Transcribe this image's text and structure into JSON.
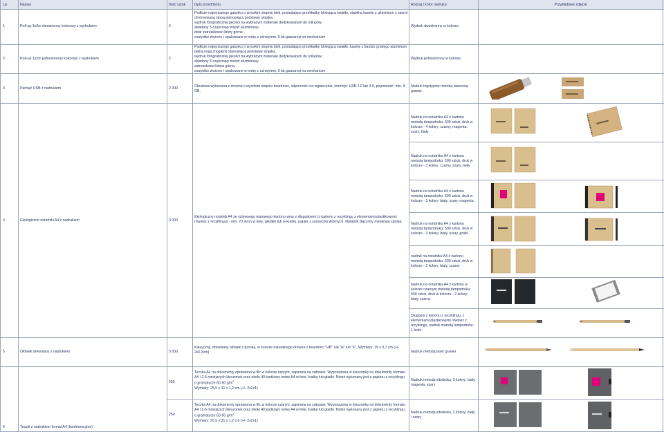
{
  "header": {
    "lp": "Lp.",
    "nazwa": "Nazwa",
    "ilosc": "Ilość sztuk",
    "opis": "Opis przedmiotu",
    "rodzaj": "Rodzaj i kolor nadruku",
    "zdjecie": "Przykładowe zdjęcie"
  },
  "rows": [
    {
      "lp": "1",
      "nazwa": "Roll-up 1x2m dwustronny kolorowy z wydrukiem",
      "ilosc": "2",
      "opis_lines": [
        "Podłoże najwyższego gatunku o wysokim stopniu bieli, posiadające przekładkę blokującą światło, stabilną kasetę z aluminium z szeroką,",
        "chromowaną stopą stanowiącą podstawę stojaka,",
        "wydruk fotograficznej jakości na wybranym materiale dedykowanym do rollupów,",
        " składany 3-częściowy maszt aluminiowy,",
        " dwie zatrzaskowe listwy górne ,",
        " wszystko złożone i spakowane w torbę z uchwytem, 5 lat gwarancji na mechanizm"
      ],
      "rodzaj": "Wydruk dwustronny w kolorze."
    },
    {
      "lp": "2",
      "nazwa": "Roll-up 1x2m jednostronny kolorowy z wydrukiem",
      "ilosc": "2",
      "opis_lines": [
        "Podłoże najwyższego gatunku o wysokim stopniu bieli, posiadające przekładkę blokującą światło, kasetę z bardzo grubego aluminium z",
        "pełną nogą (nogami) stanowiącą podstawę stojaka,",
        "wydruk fotograficznej jakości na wybranym materiale dedykowanym do rollupów,",
        "składany 3-częściowy maszt aluminiowy,",
        " zatrzaskowa listwa górna,",
        "wszystko złożone i spakowane w torbę z uchwytem, 5 lat gwarancji na mechanizm"
      ],
      "rodzaj": "Wydruk jednostronny w kolorze."
    },
    {
      "lp": "3",
      "nazwa": "Pamięć USB z nadrukiem",
      "ilosc": "2 000",
      "opis": "Obudowa wykonana z drewna o wysokim stopniu twardości, odporności na wgniecenia, interfejs: USB 2.0 lub 3.0, pojemność: min. 8 GB.",
      "rodzaj": "Nadruk logotypów metodą laserową grawer."
    },
    {
      "lp": "4",
      "nazwa": "Ekologiczne notatniki A4 z nadrukiem",
      "ilosc": "3 000",
      "opis": "Ekologiczny notatnik A4 ze sztywnego matowego kartonu wraz z długopisem (z kartonu z recyklingu z elementami plastikowymi również z recyklingu) - min. 70 stron w linie, gładkie lub w kratkę, papier z surowców wtórnych. Notatnik złączony metalową spiralą.",
      "variants": [
        "Nadruk na notatniku A4 z kartonu metodą tampodruku: 500 sztuk, druk w kolorze - 4 kolory: czarny, magenta, szary, biały",
        "Nadruk na notatniku A4 z kartonu metodą tampodruku: 500 sztuk, druk w kolorze - 3 kolory: czarny, szary, biały",
        "Nadruk na notatniku A4 z kartonu metodą tampodruku: 500 sztuk, druk w kolorze - 3 kolory: biały, szary, magenta",
        "Nadruk na notatniku A4 z kartonu metodą tampodruku: 500 sztuk, druk w kolorze - 3 kolory: biały, szary, grafit.",
        "nadruk na notatniku A4 z kartonu metodą tampodruku: 500 sztuk, druk w kolorze - 2 kolory: biały, czarny",
        "Nadruk na notatniku A4 z kartonu w kolorze czarnym metodą tampodruku: 500 sztuk, druk w kolorze - 2 kolory: biały, czarny",
        "Długopis z kartonu z recyklingu, z elementami plastikowymi również z recyklingu, nadruk metodą tampodruku - 1 kolor"
      ]
    },
    {
      "lp": "5",
      "nazwa": "Ołówek drewniany z nadrukiem",
      "ilosc": "5 000",
      "opis": "Klasyczny, drewniany ołówek z gumką, w kolorze naturalnego drewna o twardości \"HB\" lub \"H\" lub \"F\", Wymiary: 19 x 0,7 cm (+/- 2x0,3cm)",
      "rodzaj": "Nadruk metodą laser grawer."
    },
    {
      "lp": "6",
      "nazwa": "Teczki z nadrukiem format A4 (konferencyjne)",
      "subrows": [
        {
          "ilosc": "250",
          "opis_main": "Teczka A4 na dokumenty oprawiona w filc w kolorze szarym, zapinana na zatrzask. Wyposażona w kieszonkę na dokumenty formatu A4 i 2-6 mniejszych kieszonek oraz około 40 kartkowy notes A4 w linie, kratkę lub gładki. Notes wykonany jest z papieru z recyklingu o gramaturze 60-90 g/m",
          "opis_sup": "2",
          "opis_dim": "Wymiary: 25,5 x 31 x 1,2 cm (+/- 2x2x1)",
          "rodzaj": "Nadruk metodą sitodruku, 3 kolory: biały, magenta, szary"
        },
        {
          "ilosc": "250",
          "opis_main": "Teczka A4 na dokumenty oprawiona w filc w kolorze szarym, zapinana na zatrzask. Wyposażona w kieszonkę na dokumenty formatu A4 i 2-6 mniejszych kieszonek oraz około 40 kartkowy notes A4 w linie, kratkę lub gładki. Notes wykonany jest z papieru z recyklingu o gramaturze 60-90 g/m",
          "opis_sup": "2",
          "opis_dim": "Wymiary: 25,5 x 31 x 1,2 cm (+/- 2x2x1)",
          "rodzaj": "Nadruk metodą sitodruku, 2 kolory: biały i szary"
        }
      ]
    }
  ],
  "colors": {
    "text": "#1f2d5a",
    "header_bg": "#dfe4ee",
    "grid": "#9aa4b8",
    "kraft": "#d9bf8e",
    "magenta": "#e2007a",
    "felt": "#6b6d70"
  }
}
